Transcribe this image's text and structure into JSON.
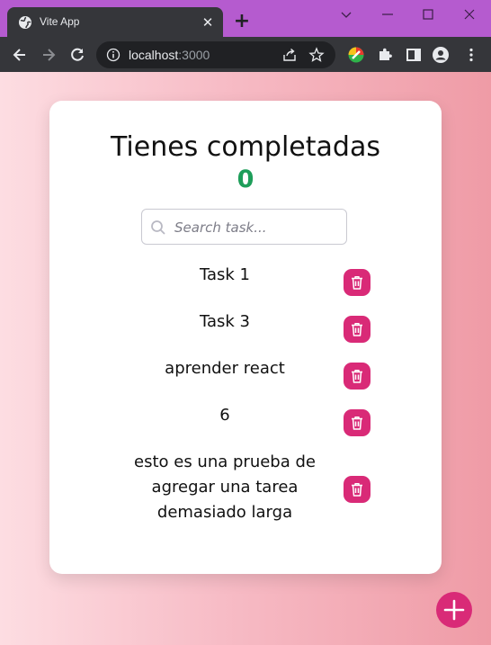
{
  "browser": {
    "tab_title": "Vite App",
    "url_host": "localhost",
    "url_port": ":3000",
    "icons": [
      "globe-icon",
      "close-icon",
      "plus-icon",
      "back-icon",
      "forward-icon",
      "reload-icon",
      "info-icon",
      "share-icon",
      "star-icon",
      "extension-colorful-icon",
      "puzzle-icon",
      "sidebar-icon",
      "profile-icon",
      "menu-dots-icon",
      "minimize-icon",
      "maximize-icon",
      "window-close-icon"
    ]
  },
  "app": {
    "heading": "Tienes completadas",
    "completed_count": "0",
    "count_color": "#1e9e5a",
    "accent_color": "#d92a77",
    "search": {
      "placeholder": "Search task...",
      "value": ""
    },
    "tasks": [
      {
        "text": "Task 1"
      },
      {
        "text": "Task 3"
      },
      {
        "text": "aprender react"
      },
      {
        "text": "6"
      },
      {
        "text": "esto es una prueba de agregar una tarea demasiado larga"
      }
    ],
    "add_button_icon": "plus-icon",
    "delete_button_icon": "trash-icon"
  }
}
